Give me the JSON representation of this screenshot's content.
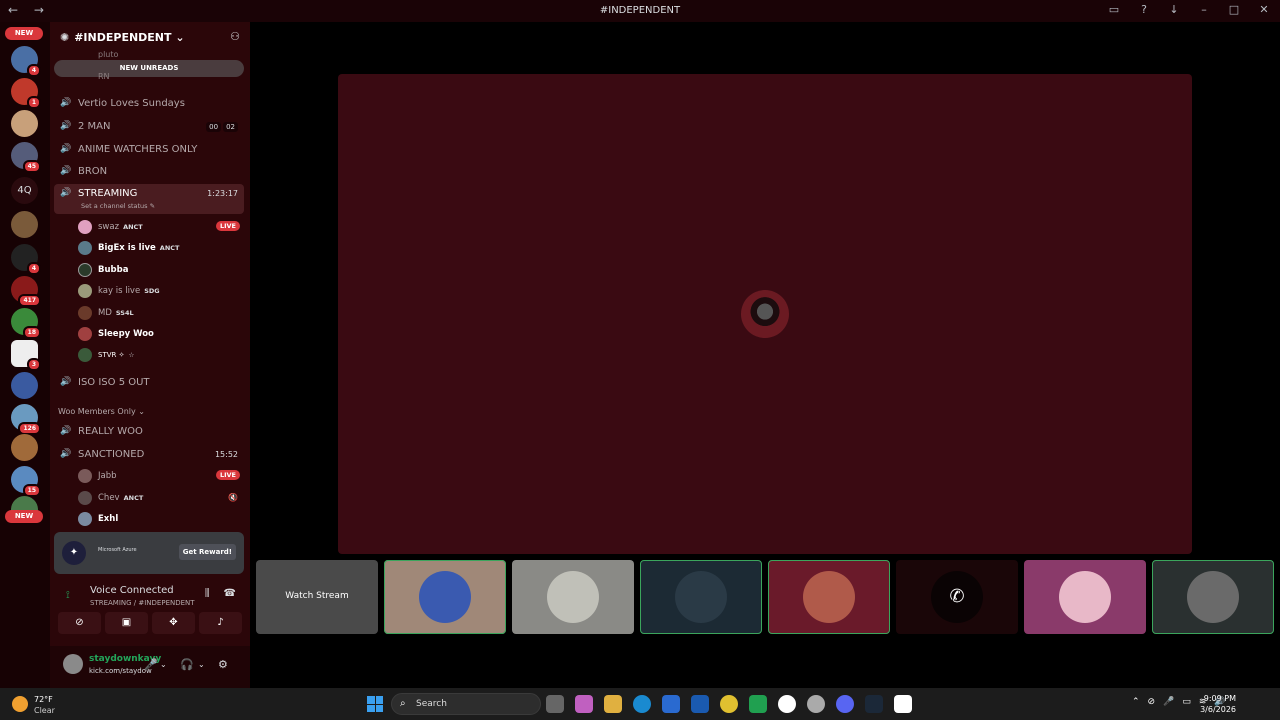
{
  "window": {
    "title": "#INDEPENDENT",
    "nav": "← →"
  },
  "servers": {
    "new_top": "NEW",
    "new_bottom": "NEW",
    "text_server": "4Q",
    "badges": [
      "4",
      "1",
      "45",
      "4",
      "417",
      "18",
      "3",
      "126",
      "15"
    ]
  },
  "guild": {
    "name": "#INDEPENDENT",
    "new_unreads": "NEW UNREADS",
    "faded_1": "pluto",
    "faded_2": "RN",
    "channels": [
      {
        "name": "Vertio Loves Sundays"
      },
      {
        "name": "2 MAN",
        "count_a": "00",
        "count_b": "02"
      },
      {
        "name": "ANIME WATCHERS ONLY"
      },
      {
        "name": "BRON"
      },
      {
        "name": "STREAMING",
        "timer": "1:23:17",
        "status": "Set a channel status"
      },
      {
        "name": "ISO ISO 5 OUT"
      },
      {
        "name": "REALLY WOO"
      },
      {
        "name": "SANCTIONED",
        "timer": "15:52"
      }
    ],
    "category": "Woo Members Only",
    "streaming_users": [
      {
        "name": "swaz",
        "tag": "ANCT",
        "live": "LIVE"
      },
      {
        "name": "BigEx is live",
        "tag": "ANCT"
      },
      {
        "name": "Bubba"
      },
      {
        "name": "kay is live",
        "tag": "SDG"
      },
      {
        "name": "MD",
        "tag": "SS4L"
      },
      {
        "name": "Sleepy Woo"
      },
      {
        "name": "STVR ✧",
        "tag": "☆"
      }
    ],
    "sanctioned_users": [
      {
        "name": "Jabb",
        "live": "LIVE"
      },
      {
        "name": "Chev",
        "tag": "ANCT"
      },
      {
        "name": "Exhl"
      }
    ]
  },
  "promo": {
    "brand": "Microsoft Azure",
    "button": "Get Reward!"
  },
  "voice": {
    "status": "Voice Connected",
    "location": "STREAMING / #INDEPENDENT"
  },
  "user": {
    "name": "staydownkayy",
    "sub": "kick.com/staydow"
  },
  "tiles": {
    "watch_stream": "Watch Stream"
  },
  "taskbar": {
    "temp": "72°F",
    "condition": "Clear",
    "search_placeholder": "Search",
    "time": "9:09 PM",
    "date": "3/6/2026"
  },
  "colors": {
    "stage": "#3a0a12",
    "accent_green": "#23a55a",
    "live_red": "#da373c"
  }
}
